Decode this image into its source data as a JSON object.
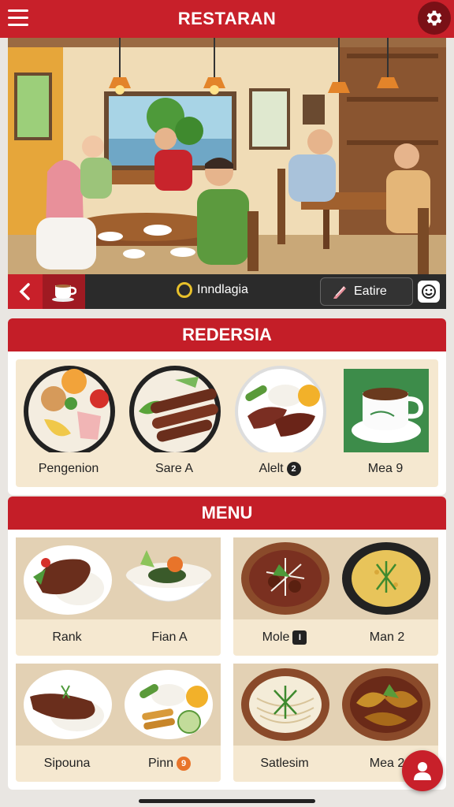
{
  "app": {
    "title": "RESTARAN"
  },
  "header": {
    "menu_icon": "hamburger-icon",
    "settings_icon": "gear-icon"
  },
  "hero_bar": {
    "back_icon": "chevron-left-icon",
    "cup_icon": "coffee-cup-icon",
    "brand_label": "Inndlagia",
    "feature_label": "Eatire",
    "smile_icon": "smile-icon"
  },
  "recommend": {
    "title": "REDERSIA",
    "items": [
      {
        "label": "Pengenion"
      },
      {
        "label": "Sare A"
      },
      {
        "label": "Alelt",
        "badge": "2"
      },
      {
        "label": "Mea 9"
      }
    ]
  },
  "menu": {
    "title": "MENU",
    "cards": [
      {
        "left": {
          "label": "Rank"
        },
        "right": {
          "label": "Fian A"
        }
      },
      {
        "left": {
          "label": "Mole",
          "badge": "I"
        },
        "right": {
          "label": "Man 2"
        }
      },
      {
        "left": {
          "label": "Sipouna"
        },
        "right": {
          "label": "Pinn",
          "badge": "9"
        }
      },
      {
        "left": {
          "label": "Satlesim"
        },
        "right": {
          "label": "Mea 2"
        }
      }
    ]
  },
  "fab": {
    "icon": "user-icon"
  },
  "colors": {
    "brand_red": "#c8202a",
    "dark_bar": "#2b2b2b",
    "card_bg": "#f5e8d0"
  }
}
